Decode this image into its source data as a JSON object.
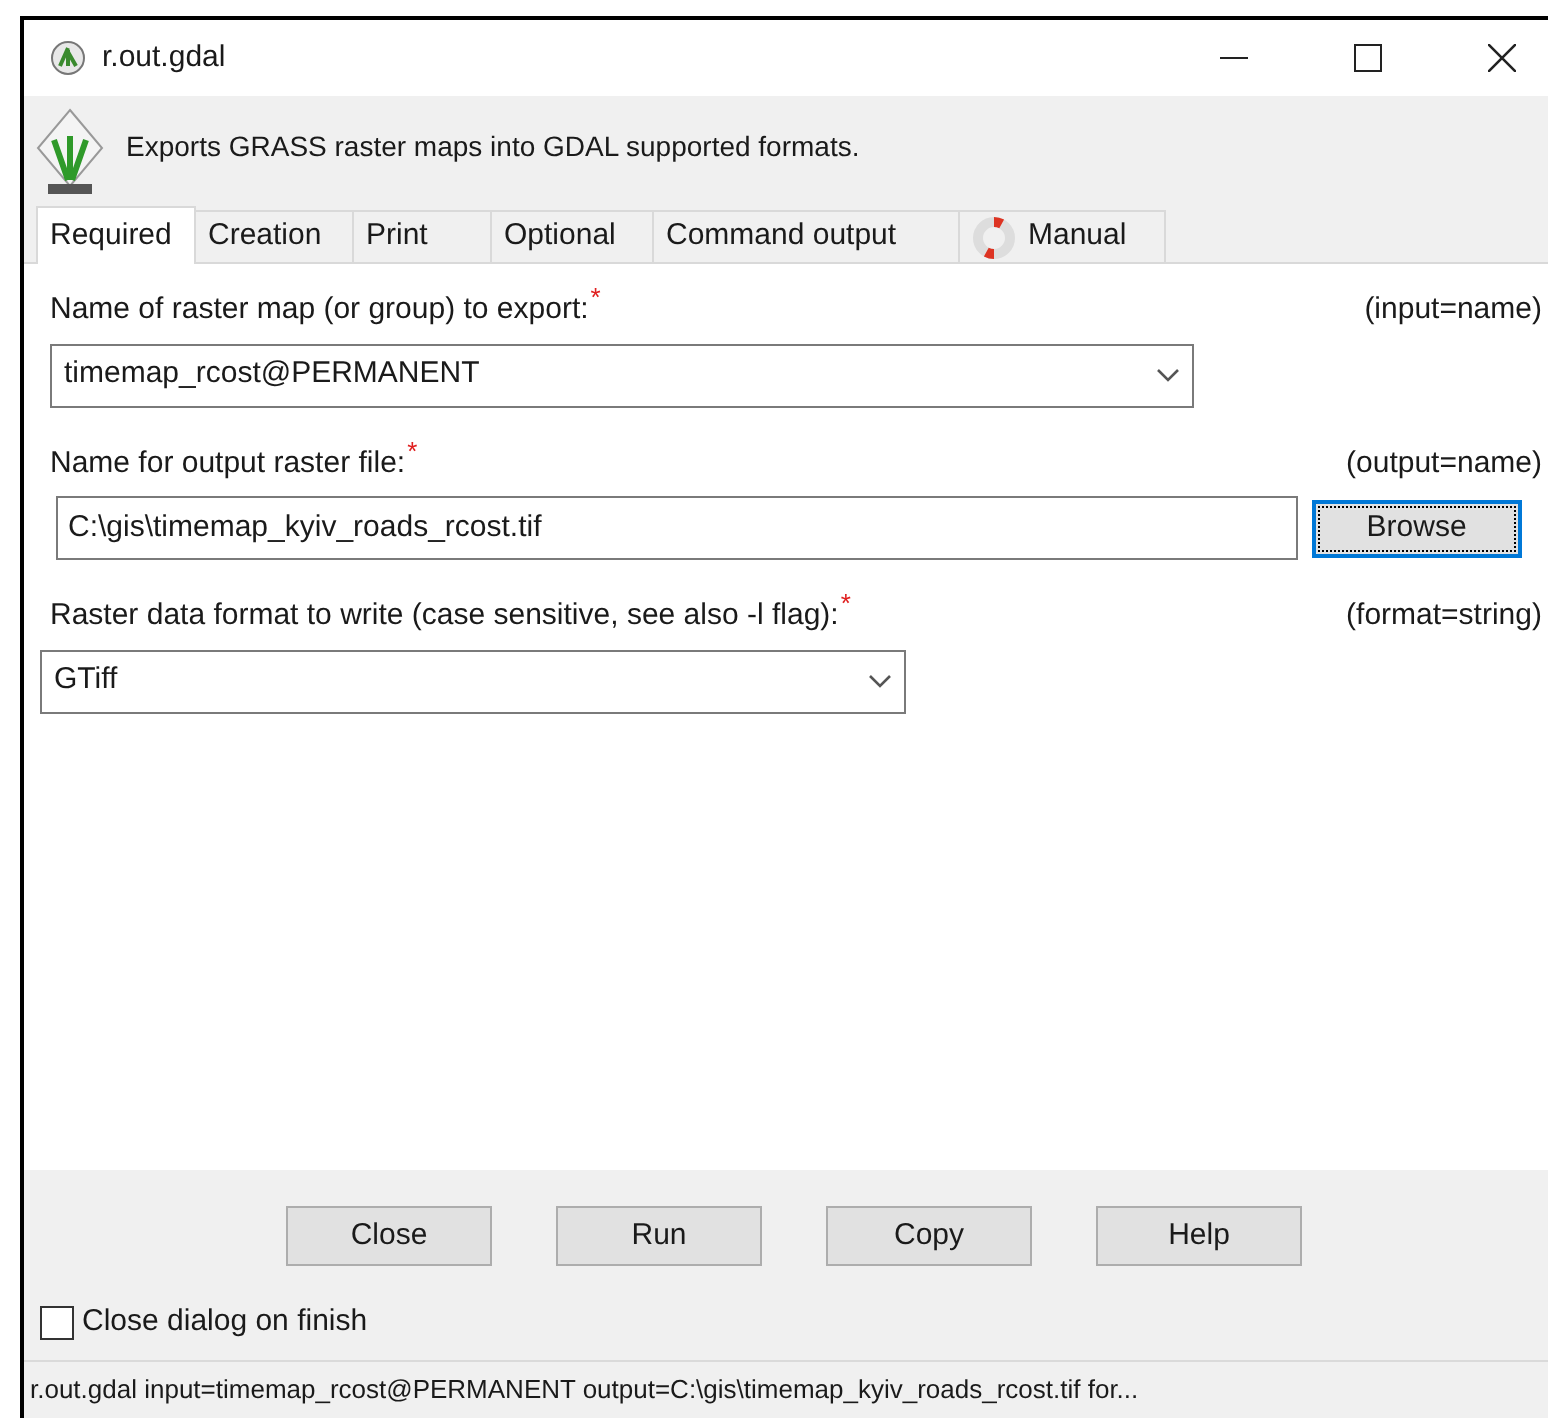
{
  "window": {
    "title": "r.out.gdal"
  },
  "description": "Exports GRASS raster maps into GDAL supported formats.",
  "tabs": [
    {
      "label": "Required",
      "selected": true,
      "kind": "plain"
    },
    {
      "label": "Creation",
      "selected": false,
      "kind": "plain"
    },
    {
      "label": "Print",
      "selected": false,
      "kind": "plain"
    },
    {
      "label": "Optional",
      "selected": false,
      "kind": "plain"
    },
    {
      "label": "Command output",
      "selected": false,
      "kind": "plain"
    },
    {
      "label": "Manual",
      "selected": false,
      "kind": "help"
    }
  ],
  "fields": [
    {
      "kind": "combo",
      "label": "Name of raster map (or group) to export:",
      "required_mark": "*",
      "hint": "(input=name)",
      "value": "timemap_rcost@PERMANENT"
    },
    {
      "kind": "file",
      "label": "Name for output raster file:",
      "required_mark": "*",
      "hint": "(output=name)",
      "value": "C:\\gis\\timemap_kyiv_roads_rcost.tif",
      "button": "Browse"
    },
    {
      "kind": "combo-short",
      "label": "Raster data format to write (case sensitive, see also -l flag):",
      "required_mark": "*",
      "hint": "(format=string)",
      "value": "GTiff"
    }
  ],
  "buttons": [
    "Close",
    "Run",
    "Copy",
    "Help"
  ],
  "close_on_finish": {
    "label": "Close dialog on finish",
    "checked": false
  },
  "status_bar": "r.out.gdal input=timemap_rcost@PERMANENT output=C:\\gis\\timemap_kyiv_roads_rcost.tif for..."
}
